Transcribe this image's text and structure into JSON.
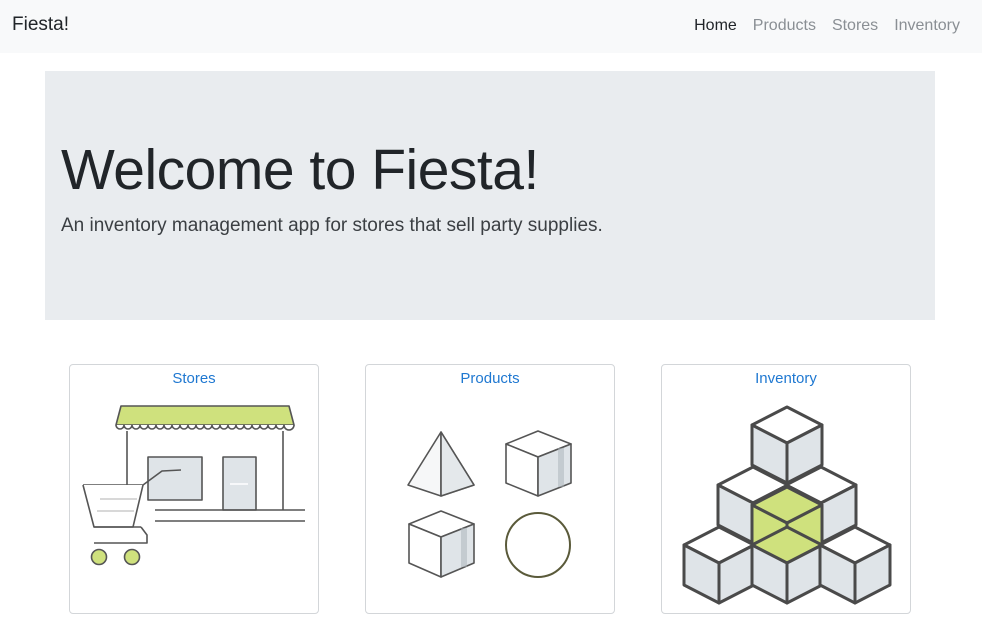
{
  "navbar": {
    "brand": "Fiesta!",
    "links": [
      {
        "label": "Home",
        "active": true
      },
      {
        "label": "Products",
        "active": false
      },
      {
        "label": "Stores",
        "active": false
      },
      {
        "label": "Inventory",
        "active": false
      }
    ]
  },
  "hero": {
    "title": "Welcome to Fiesta!",
    "subtitle": "An inventory management app for stores that sell party supplies."
  },
  "cards": [
    {
      "label": "Stores",
      "icon": "storefront-cart-icon"
    },
    {
      "label": "Products",
      "icon": "shapes-icon"
    },
    {
      "label": "Inventory",
      "icon": "stacked-cubes-icon"
    }
  ],
  "colors": {
    "link": "#1f78d1",
    "accent_green": "#cfe17d",
    "jumbotron_bg": "#e9ecef",
    "navbar_bg": "#f8f9fa",
    "icon_fill": "#dfe4e8",
    "icon_stroke": "#555555"
  }
}
